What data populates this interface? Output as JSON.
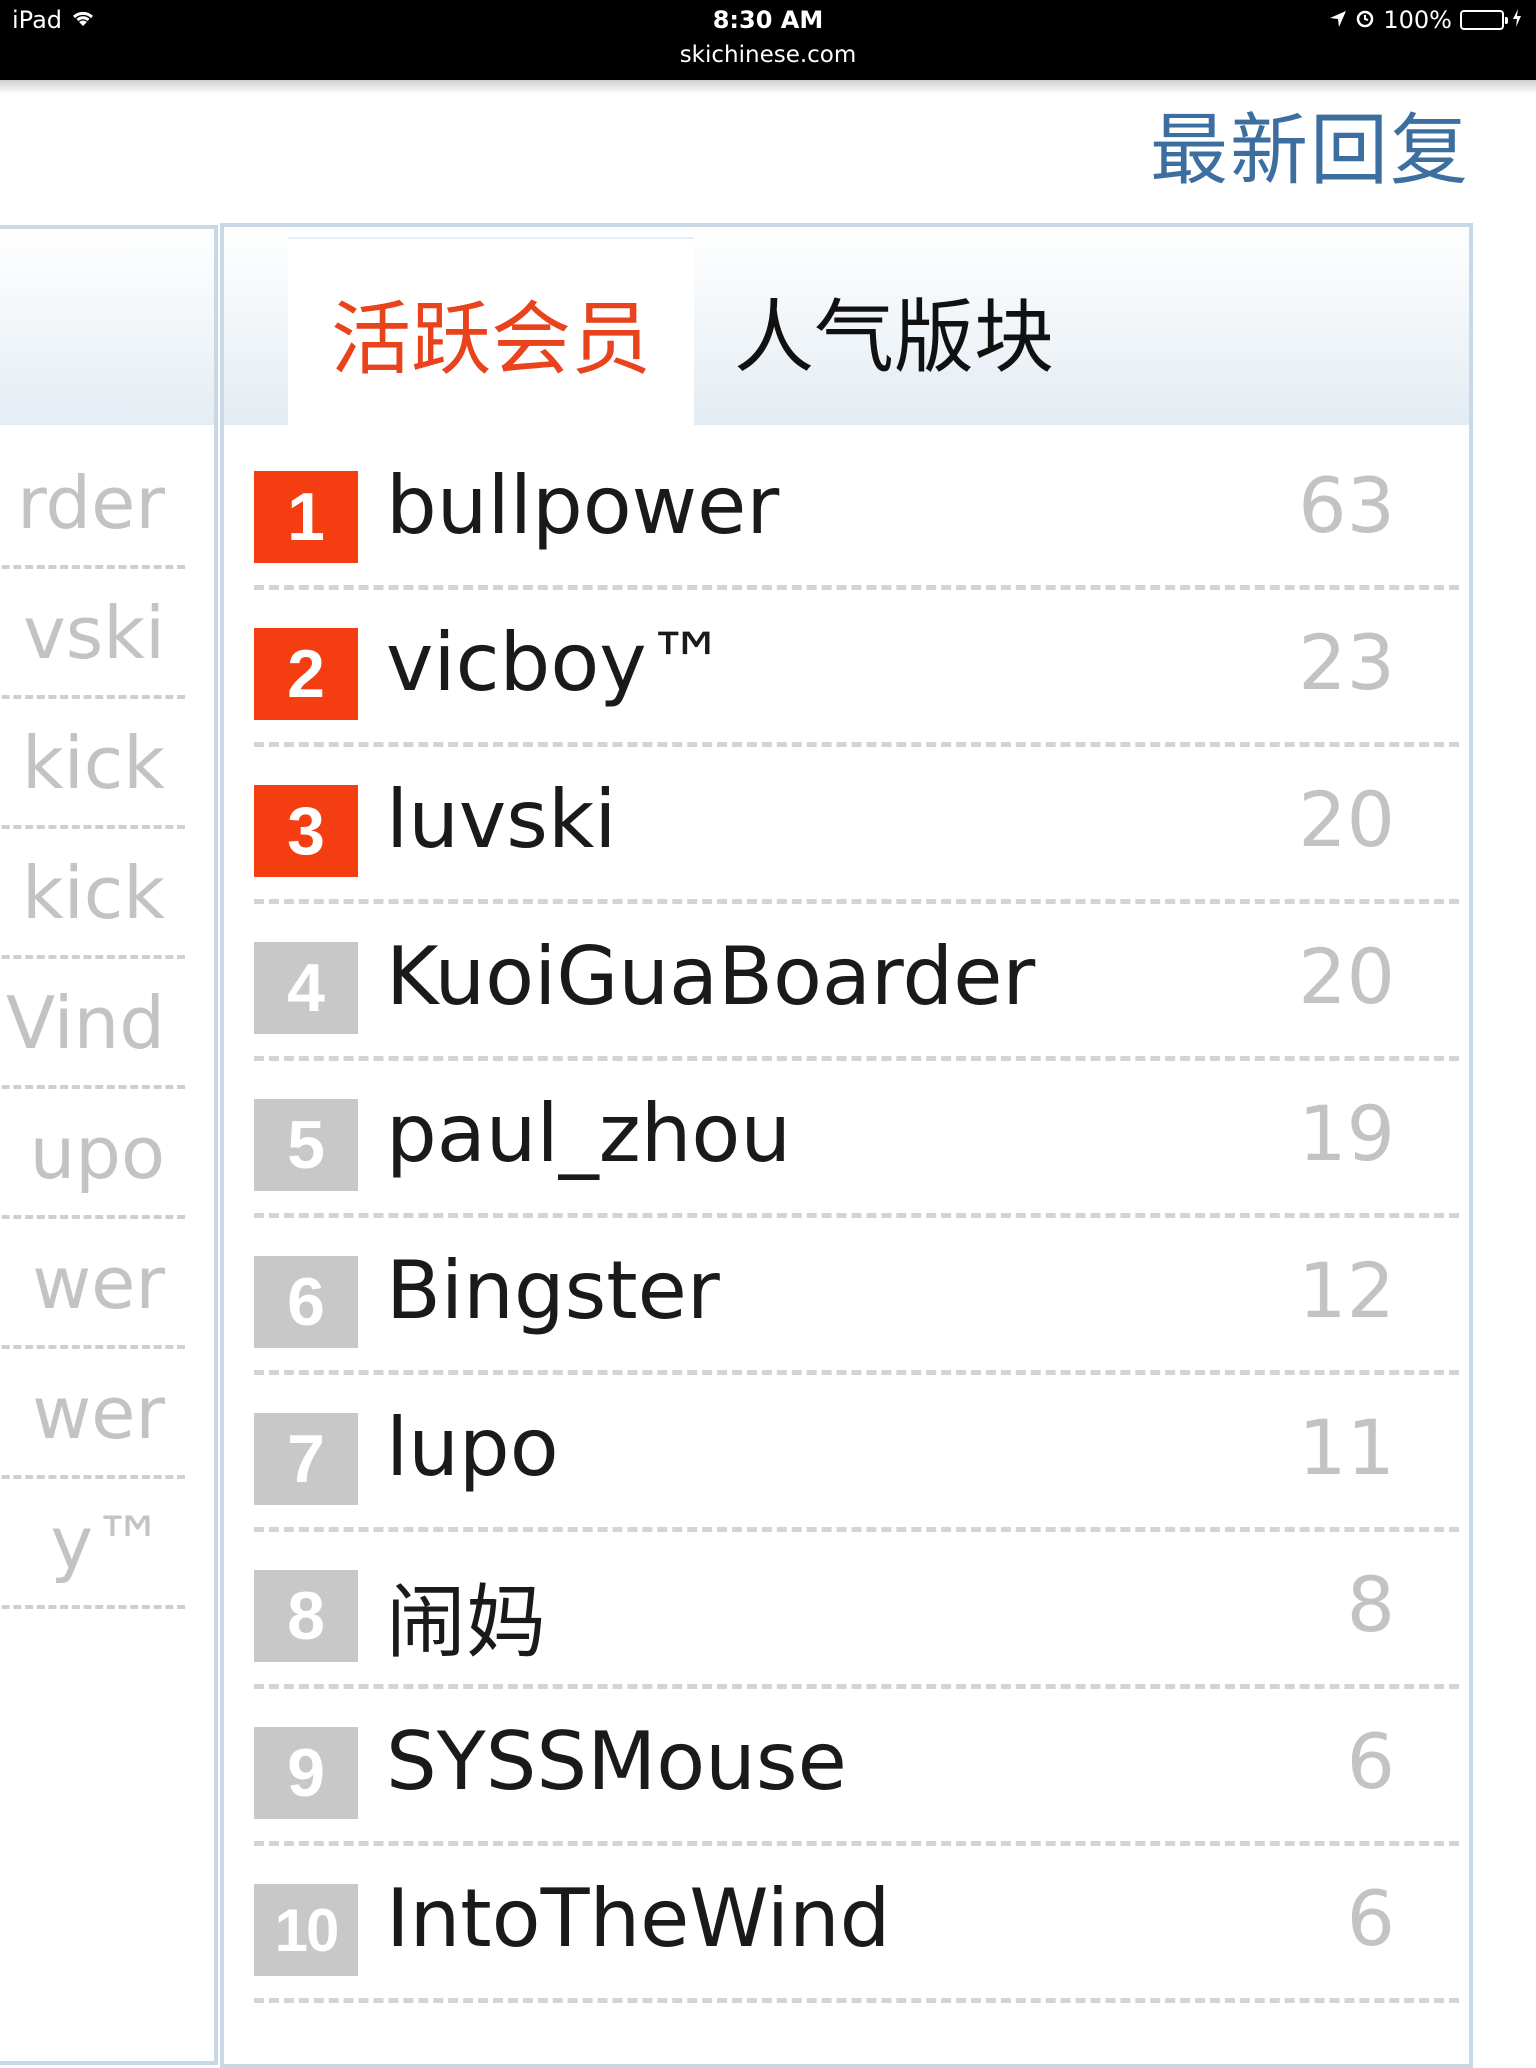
{
  "status_bar": {
    "device": "iPad",
    "time": "8:30 AM",
    "url": "skichinese.com",
    "battery": "100%",
    "battery_level": 1.0
  },
  "header": {
    "section_title": "最新回复"
  },
  "left_panel": {
    "items": [
      "rder",
      "vski",
      "kick",
      "kick",
      "Vind",
      "upo",
      "wer",
      "wer",
      "y™"
    ]
  },
  "tabs": [
    {
      "label": "活跃会员",
      "active": true
    },
    {
      "label": "人气版块",
      "active": false
    }
  ],
  "colors": {
    "accent_active_tab": "#e8431c",
    "top_badge": "#f43d10",
    "rest_badge": "#c8c8c8",
    "heading": "#3d6ea0"
  },
  "rankings": [
    {
      "rank": "1",
      "name": "bullpower",
      "count": "63"
    },
    {
      "rank": "2",
      "name": "vicboy™",
      "count": "23"
    },
    {
      "rank": "3",
      "name": "luvski",
      "count": "20"
    },
    {
      "rank": "4",
      "name": "KuoiGuaBoarder",
      "count": "20"
    },
    {
      "rank": "5",
      "name": "paul_zhou",
      "count": "19"
    },
    {
      "rank": "6",
      "name": "Bingster",
      "count": "12"
    },
    {
      "rank": "7",
      "name": "lupo",
      "count": "11"
    },
    {
      "rank": "8",
      "name": "闹妈",
      "count": "8"
    },
    {
      "rank": "9",
      "name": "SYSSMouse",
      "count": "6"
    },
    {
      "rank": "10",
      "name": "IntoTheWind",
      "count": "6"
    }
  ]
}
